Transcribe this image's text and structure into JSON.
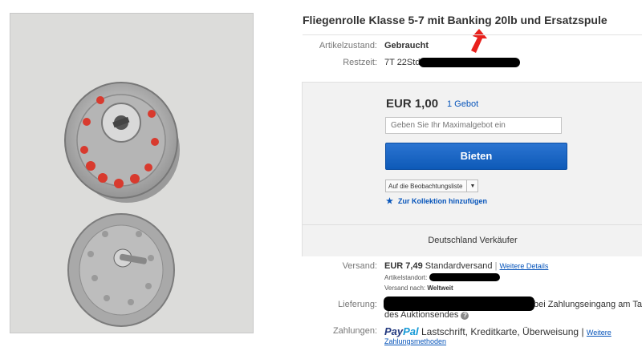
{
  "listing": {
    "title": "Fliegenrolle Klasse 5-7 mit Banking 20lb und Ersatzspule",
    "condition_label": "Artikelzustand:",
    "condition_value": "Gebraucht",
    "time_label": "Restzeit:",
    "time_value": "7T 22Std"
  },
  "bid": {
    "price": "EUR 1,00",
    "bid_count": "1 Gebot",
    "max_bid_placeholder": "Geben Sie Ihr Maximalgebot ein",
    "bid_button": "Bieten",
    "watchlist": "Auf die Beobachtungsliste",
    "collection": "Zur Kollektion hinzufügen",
    "seller": "Deutschland Verkäufer"
  },
  "shipping": {
    "label": "Versand:",
    "price": "EUR 7,49",
    "method": "Standardversand",
    "divider": "|",
    "details_link": "Weitere Details",
    "location_label": "Artikelstandort:",
    "ship_to_label": "Versand nach:",
    "ship_to_value": "Weltweit"
  },
  "delivery": {
    "label": "Lieferung:",
    "text_line1": "bei Zahlungseingang am Tag",
    "text_line2": "des Auktionsendes"
  },
  "payment": {
    "label": "Zahlungen:",
    "paypal_pay": "Pay",
    "paypal_pal": "Pal",
    "methods": "Lastschrift, Kreditkarte, Überweisung",
    "divider": "|",
    "more_link_1": "Weitere",
    "more_link_2": "Zahlungsmethoden"
  },
  "colors": {
    "accent_blue": "#0654ba",
    "button_blue": "#1460c3",
    "arrow_red": "#e8201c",
    "paypal_dark": "#253b80",
    "paypal_light": "#179bd7"
  }
}
